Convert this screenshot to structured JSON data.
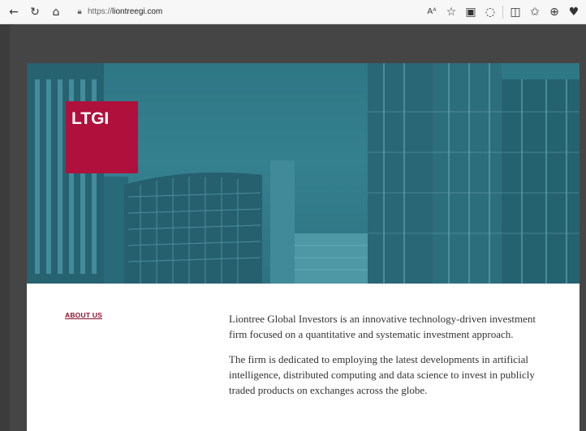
{
  "browser": {
    "url_prefix": "https://",
    "url_domain": "liontreegi.com",
    "icons": {
      "back": "back-arrow-icon",
      "refresh": "refresh-icon",
      "home": "home-icon",
      "lock": "lock-icon",
      "read_aloud": "read-aloud-icon",
      "favorite": "star-icon"
    },
    "read_aloud_label": "Aᴬ"
  },
  "hero": {
    "logo_text": "LTGI",
    "logo_color": "#b0103c"
  },
  "content": {
    "about_link": "ABOUT US",
    "paragraphs": [
      "Liontree Global Investors is an innovative technology-driven investment firm focused on a quantitative and systematic investment approach.",
      "The firm is dedicated to employing the latest developments in artificial intelligence, distributed computing and data science to invest in publicly traded products on exchanges across the globe."
    ]
  }
}
